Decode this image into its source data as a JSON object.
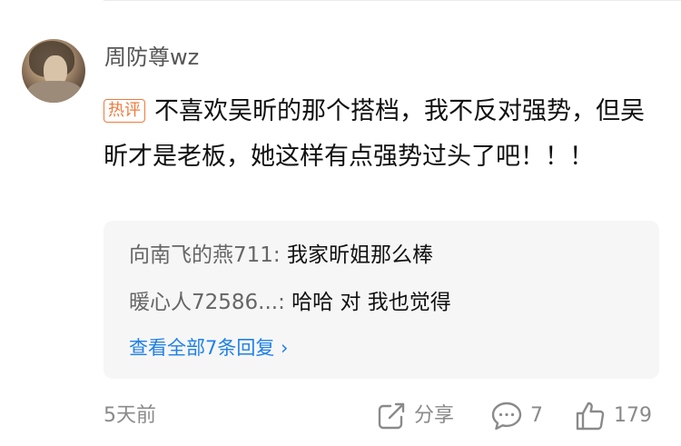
{
  "comment": {
    "username": "周防尊wz",
    "badge": "热评",
    "text": "不喜欢吴昕的那个搭档，我不反对强势，但吴昕才是老板，她这样有点强势过头了吧！！！"
  },
  "replies": [
    {
      "author": "向南飞的燕711:",
      "text": "我家昕姐那么棒"
    },
    {
      "author": "暖心人72586...:",
      "text": "哈哈 对 我也觉得"
    }
  ],
  "view_all": "查看全部7条回复 ›",
  "footer": {
    "time": "5天前",
    "share_label": "分享",
    "reply_count": "7",
    "like_count": "179"
  },
  "colors": {
    "badge": "#f07a3c",
    "link": "#1e80e8",
    "reply_bg": "#f6f6f6"
  }
}
